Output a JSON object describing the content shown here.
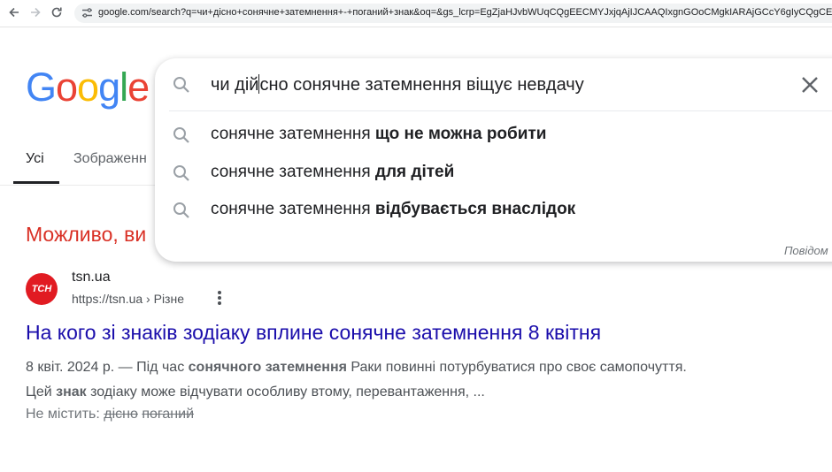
{
  "browser": {
    "url": "google.com/search?q=чи+дісно+сонячне+затемнення+-+поганий+знак&oq=&gs_lcrp=EgZjaHJvbWUqCQgEECMYJxjqAjIJCAAQIxgnGOoCMgkIARAjGCcY6gIyCQgCECMYJxjqAjIJCAMQIxgnGOoC"
  },
  "logo": {
    "letters": [
      "G",
      "o",
      "o",
      "g",
      "l",
      "e"
    ]
  },
  "tabs": [
    {
      "label": "Усі"
    },
    {
      "label": "Зображенн"
    }
  ],
  "maybe_meant": {
    "text": "Можливо, ви"
  },
  "search": {
    "query_before_cursor": "чи дій",
    "query_after_cursor": "сно сонячне затемнення віщує невдачу",
    "suggestions": [
      {
        "prefix": "сонячне затемнення ",
        "bold": "що не можна робити"
      },
      {
        "prefix": "сонячне затемнення ",
        "bold": "для дітей"
      },
      {
        "prefix": "сонячне затемнення ",
        "bold": "відбувається внаслідок"
      }
    ],
    "report_label": "Повідом"
  },
  "result": {
    "favicon_text": "ТСН",
    "site_name": "tsn.ua",
    "site_url": "https://tsn.ua › Різне",
    "title": "На кого зі знаків зодіаку вплине сонячне затемнення 8 квітня",
    "snippet": {
      "date": "8 квіт. 2024 р. — ",
      "part1": "Під час ",
      "bold1": "сонячного затемнення",
      "part2": " Раки повинні потурбуватися про своє самопочуття. Цей ",
      "bold2": "знак",
      "part3": " зодіаку може відчувати особливу втому, перевантаження, ..."
    },
    "missing": {
      "label": "Не містить: ",
      "words": [
        "дісно",
        "поганий"
      ]
    }
  },
  "colors": {
    "link": "#1a0dab",
    "maybe": "#d93025",
    "favicon_bg": "#e11b22"
  }
}
